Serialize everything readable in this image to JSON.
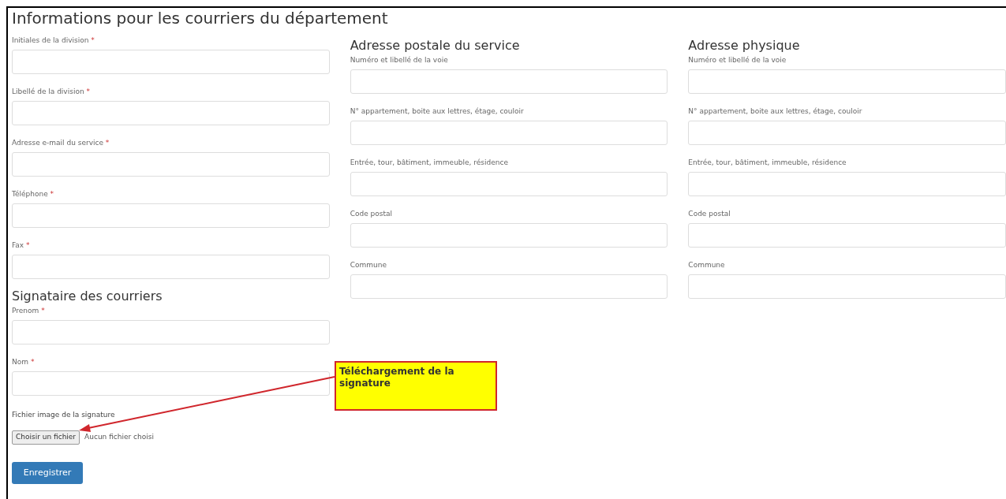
{
  "title": "Informations pour les courriers du département",
  "division_fields": [
    {
      "label": "Initiales de la division",
      "required_mark": "*"
    },
    {
      "label": "Libellé de la division",
      "required_mark": "*"
    },
    {
      "label": "Adresse e-mail du service",
      "required_mark": "*"
    },
    {
      "label": "Téléphone",
      "required_mark": "*"
    },
    {
      "label": "Fax",
      "required_mark": "*"
    }
  ],
  "signatory": {
    "title": "Signataire des courriers",
    "fields": [
      {
        "label": "Prenom",
        "required_mark": "*"
      },
      {
        "label": "Nom",
        "required_mark": "*"
      }
    ],
    "file": {
      "label": "Fichier image de la signature",
      "button": "Choisir un fichier",
      "status": "Aucun fichier choisi"
    }
  },
  "address_sections": [
    {
      "title": "Adresse postale du service",
      "fields": [
        {
          "label": "Numéro et libellé de la voie"
        },
        {
          "label": "N° appartement, boite aux lettres, étage, couloir"
        },
        {
          "label": "Entrée, tour, bâtiment, immeuble, résidence"
        },
        {
          "label": "Code postal"
        },
        {
          "label": "Commune"
        }
      ]
    },
    {
      "title": "Adresse physique",
      "fields": [
        {
          "label": "Numéro et libellé de la voie"
        },
        {
          "label": "N° appartement, boite aux lettres, étage, couloir"
        },
        {
          "label": "Entrée, tour, bâtiment, immeuble, résidence"
        },
        {
          "label": "Code postal"
        },
        {
          "label": "Commune"
        }
      ]
    }
  ],
  "save_button": "Enregistrer",
  "callout": {
    "text": "Téléchargement de la signature"
  }
}
